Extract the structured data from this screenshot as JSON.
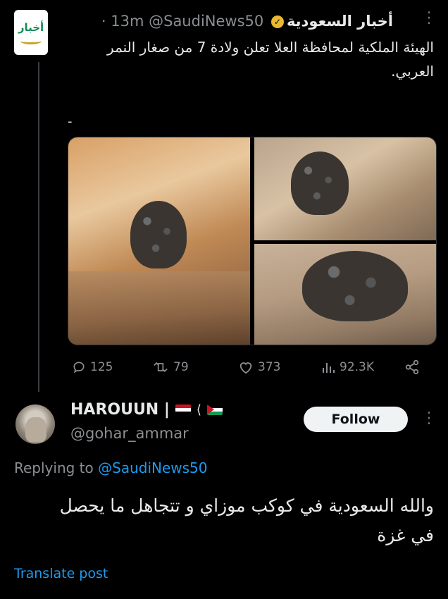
{
  "tweet": {
    "account_logo_text": "أخبار",
    "account_name": "أخبار السعودية",
    "handle": "@SaudiNews50",
    "time": "· 13m",
    "more_icon": "⋮",
    "line1": "الهيئة الملكية لمحافظة العلا تعلن ولادة 7 من صغار النمر",
    "line2": "العربي.",
    "dash": "-",
    "media_count": 3,
    "stats": {
      "replies": "125",
      "reposts": "79",
      "likes": "373",
      "views": "92.3K"
    }
  },
  "reply": {
    "name": "HAROUUN |",
    "flag_separator": "⟨",
    "handle": "@gohar_ammar",
    "follow_label": "Follow",
    "more_icon": "⋮",
    "replying_prefix": "Replying to",
    "replying_handle": "@SaudiNews50",
    "line1": "والله السعودية في كوكب موزاي و تتجاهل ما يحصل",
    "line2": "في غزة",
    "translate_label": "Translate post"
  },
  "colors": {
    "background": "#000000",
    "text": "#e7e9ea",
    "muted": "#8b8f93",
    "link": "#1d9bf0",
    "verified_badge": "#e8b931"
  }
}
